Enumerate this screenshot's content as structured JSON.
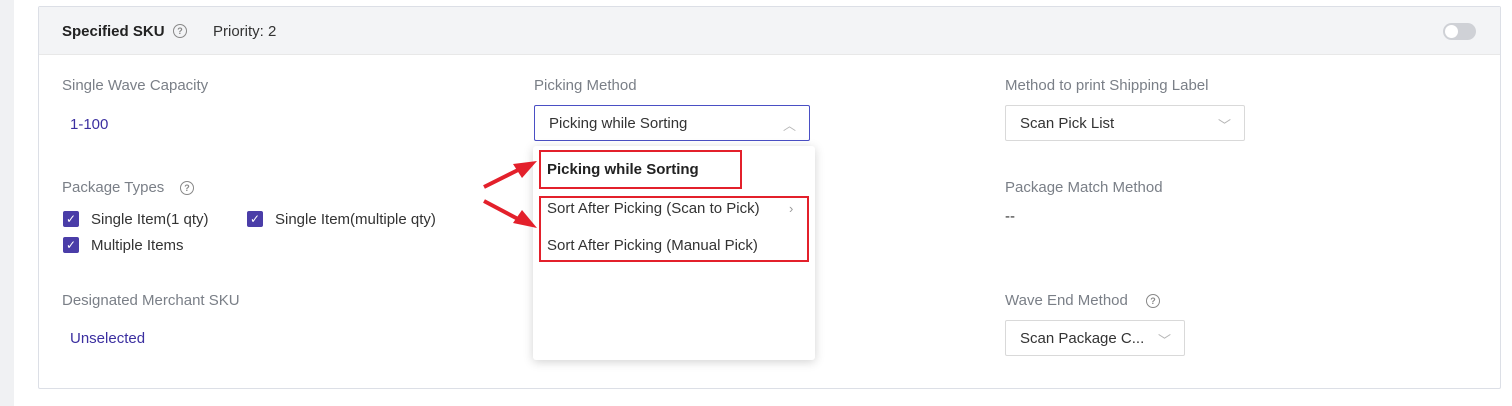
{
  "card": {
    "title": "Specified SKU",
    "priority": "Priority: 2",
    "enabled": false
  },
  "fields": {
    "single_wave_capacity": {
      "label": "Single Wave Capacity",
      "value": "1-100"
    },
    "picking_method": {
      "label": "Picking Method",
      "value": "Picking while Sorting"
    },
    "print_label_method": {
      "label": "Method to print Shipping Label",
      "value": "Scan Pick List"
    },
    "package_types": {
      "label": "Package Types",
      "options": [
        {
          "label": "Single Item(1 qty)",
          "checked": true
        },
        {
          "label": "Single Item(multiple qty)",
          "checked": true
        },
        {
          "label": "Multiple Items",
          "checked": true
        }
      ]
    },
    "package_match_method": {
      "label": "Package Match Method",
      "value": "--"
    },
    "designated_merchant_sku": {
      "label": "Designated Merchant SKU",
      "value": "Unselected"
    },
    "wave_end_method": {
      "label": "Wave End Method",
      "value": "Scan Package C..."
    }
  },
  "dropdown": {
    "options": [
      "Picking while Sorting",
      "Sort After Picking (Scan to Pick)",
      "Sort After Picking (Manual Pick)"
    ],
    "selected_index": 0
  },
  "icons": {
    "help": "question-circle-icon",
    "chevron": "chevron-down-icon",
    "check": "checkmark-icon",
    "toggle": "toggle-switch"
  },
  "colors": {
    "accent": "#4a3da8",
    "link": "#3b2fa0",
    "annotation": "#e3202b"
  }
}
